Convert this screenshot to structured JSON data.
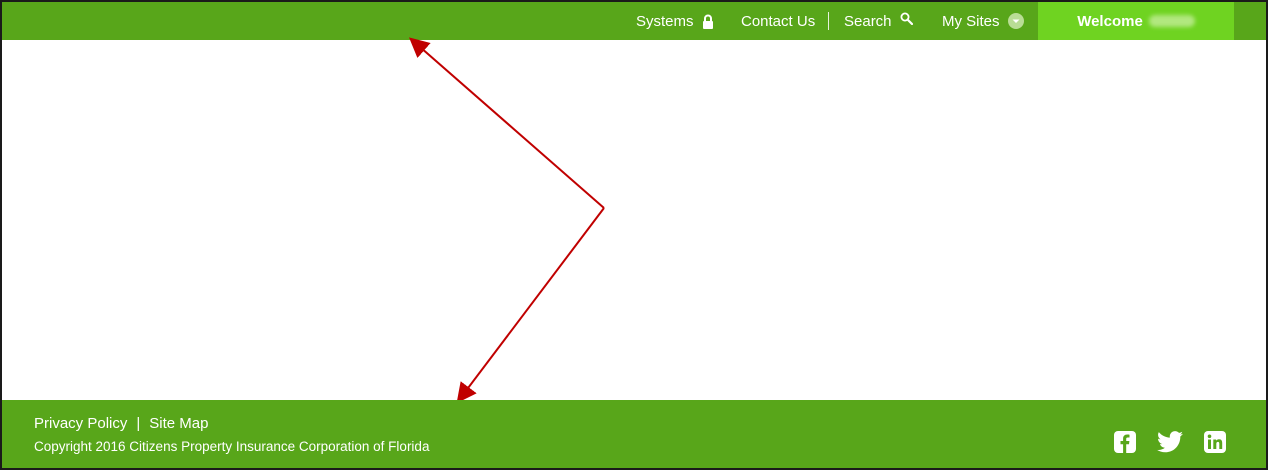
{
  "header": {
    "nav": [
      {
        "label": "Systems",
        "icon": "lock-icon"
      },
      {
        "label": "Contact Us"
      },
      {
        "label": "Search",
        "icon": "search-icon"
      },
      {
        "label": "My Sites",
        "icon": "chevron-down-circle-icon"
      }
    ],
    "welcome_label": "Welcome"
  },
  "footer": {
    "links": [
      "Privacy Policy",
      "Site Map"
    ],
    "separator": "|",
    "copyright": "Copyright 2016 Citizens Property Insurance Corporation of Florida",
    "social": [
      "facebook-icon",
      "twitter-icon",
      "linkedin-icon"
    ]
  },
  "colors": {
    "brand_green": "#58a61a",
    "welcome_green": "#6fd321",
    "annotation_arrow": "#c00000"
  }
}
